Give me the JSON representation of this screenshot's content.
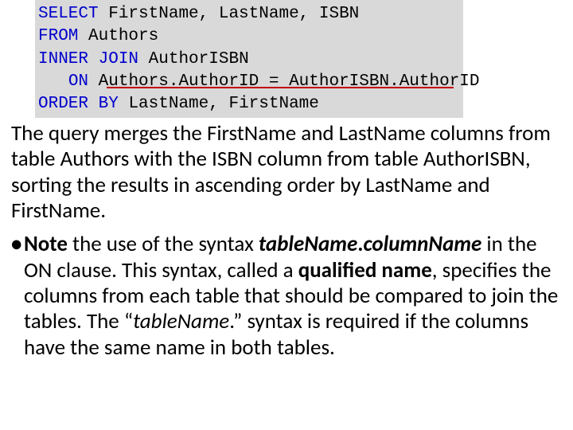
{
  "code": {
    "l1a": "SELECT",
    "l1b": " FirstName, LastName, ISBN",
    "l2a": "FROM",
    "l2b": " Authors",
    "l3a": "INNER",
    "l3b": " ",
    "l3c": "JOIN",
    "l3d": " AuthorISBN",
    "l4a": "   ",
    "l4b": "ON",
    "l4c": " Authors.AuthorID = AuthorISBN.AuthorID",
    "l5a": "ORDER",
    "l5b": " ",
    "l5c": "BY",
    "l5d": " LastName, FirstName"
  },
  "para1": "The query merges the FirstName and LastName columns from table Authors with the ISBN column from table AuthorISBN, sorting the results in ascending order by LastName and FirstName.",
  "note": {
    "bullet": "•",
    "lead": "Note",
    "t1": " the use of the syntax ",
    "em1": "tableName",
    "dot": ".",
    "em2": "columnName",
    "t2": " in the ON clause. This syntax, called a ",
    "em3": "qualified name",
    "t3": ", specifies the columns from each table that should be compared to join the tables. The “",
    "em4": "tableName",
    "t4": ".” syntax is required if the columns have the same name in both tables."
  }
}
